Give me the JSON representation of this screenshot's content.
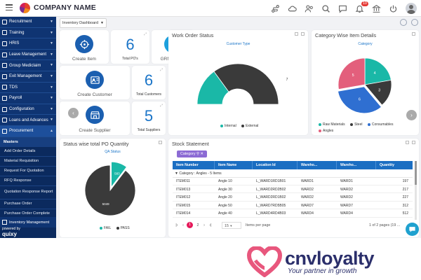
{
  "header": {
    "company_name": "COMPANY NAME",
    "notification_badge": "10",
    "icons": [
      "menu-icon",
      "company-logo",
      "routes-icon",
      "cloud-icon",
      "users-icon",
      "search-icon",
      "chat-icon",
      "notification-icon",
      "bank-icon",
      "power-icon",
      "avatar"
    ]
  },
  "sidebar": {
    "items": [
      {
        "label": "Recruitment",
        "has_children": true
      },
      {
        "label": "Training",
        "has_children": true
      },
      {
        "label": "HRIS",
        "has_children": true
      },
      {
        "label": "Leave Management",
        "has_children": true
      },
      {
        "label": "Group Mediclaim",
        "has_children": true
      },
      {
        "label": "Exit Management",
        "has_children": true
      },
      {
        "label": "TDS",
        "has_children": true
      },
      {
        "label": "Payroll",
        "has_children": true
      },
      {
        "label": "Configuration",
        "has_children": true
      },
      {
        "label": "Loans and Advances",
        "has_children": true
      },
      {
        "label": "Procurement",
        "has_children": true
      }
    ],
    "sub_header": "Masters",
    "sub_items": [
      "Add Order Details",
      "Material Requisition",
      "Request For Quotation",
      "RFQ Response",
      "Quotation Response Report",
      "Purchase Order",
      "Purchase Order Complete"
    ],
    "bottom_item": "Inventory Management",
    "brand_prefix": "powered by",
    "brand_name": "quixy"
  },
  "toolbar": {
    "dashboard_selected": "Inventory Dashboard"
  },
  "kpi": {
    "create_item": "Create Item",
    "total_pos_value": "6",
    "total_pos_label": "Total PO's",
    "grn_report": "GRN Report",
    "create_customer": "Create Customer",
    "total_customers_value": "6",
    "total_customers_label": "Total Customers",
    "create_supplier": "Create Supplier",
    "total_suppliers_value": "5",
    "total_suppliers_label": "Total Suppliers"
  },
  "work_order": {
    "title": "Work Order Status",
    "subtitle": "Customer Type",
    "label_external": "7",
    "legend": [
      "Internal",
      "External"
    ]
  },
  "category_wise": {
    "title": "Category Wise Item Details",
    "subtitle": "Category",
    "legend": [
      "Raw Materials",
      "Steel",
      "Consumables",
      "Angles"
    ]
  },
  "status_wise": {
    "title": "Status wise total PO Quantity",
    "subtitle": "QA Status",
    "legend": [
      "FAIL",
      "PASS"
    ]
  },
  "stock": {
    "title": "Stock Statement",
    "chip": "Category",
    "columns": [
      "Item Number",
      "Item Name",
      "Location Id",
      "Wareho...",
      "Wareho...",
      "Quantity"
    ],
    "group": "Category : Angles - 5 Items",
    "rows": [
      [
        "ITEM011",
        "Angle 10",
        "L_WARD1RD1B01",
        "WARD1",
        "WARD1",
        "197"
      ],
      [
        "ITEM013",
        "Angle 30",
        "L_WARD2RD2B02",
        "WARD2",
        "WARD2",
        "217"
      ],
      [
        "ITEM012",
        "Angle 20",
        "L_WARD2RD1B02",
        "WARD2",
        "WARD2",
        "227"
      ],
      [
        "ITEM015",
        "Angle 50",
        "L_WARD7RD5B05",
        "WARD7",
        "WARD7",
        "312"
      ],
      [
        "ITEM014",
        "Angle 40",
        "L_WARD4RD4B03",
        "WARD4",
        "WARD4",
        "512"
      ]
    ],
    "pager": {
      "pages": [
        "1",
        "2"
      ],
      "page_size": "15",
      "items_per_page": "Items per page",
      "summary": "1 of 2 pages (19 ..."
    }
  },
  "logo": {
    "name": "cnvloyalty",
    "tagline": "Your partner in growth"
  },
  "chart_data": [
    {
      "type": "pie",
      "title": "Work Order Status",
      "subtitle": "Customer Type",
      "labels": [
        "Internal",
        "External"
      ],
      "values": [
        3,
        7
      ],
      "colors": [
        "#1ab8a7",
        "#3a3a3a"
      ]
    },
    {
      "type": "pie",
      "title": "Category Wise Item Details",
      "subtitle": "Category",
      "labels": [
        "Raw Materials",
        "Steel",
        "Consumables",
        "Angles"
      ],
      "values": [
        4,
        3,
        6,
        5
      ],
      "colors": [
        "#1ab8a7",
        "#3a3a3a",
        "#2f6fd1",
        "#e35f7c"
      ]
    },
    {
      "type": "pie",
      "title": "Status wise total PO Quantity",
      "subtitle": "QA Status",
      "labels": [
        "FAIL",
        "PASS"
      ],
      "values": [
        583,
        5049
      ],
      "colors": [
        "#1ab8a7",
        "#3a3a3a"
      ]
    }
  ]
}
